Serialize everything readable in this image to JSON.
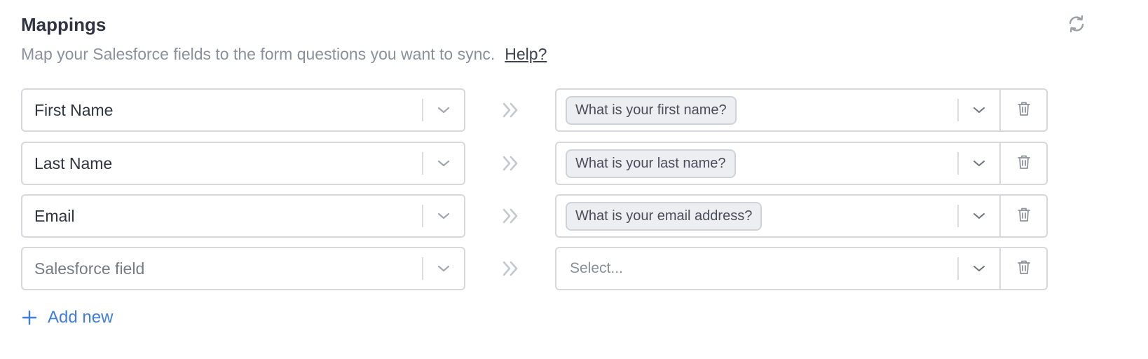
{
  "header": {
    "title": "Mappings",
    "subtitle": "Map your Salesforce fields to the form questions you want to sync.",
    "help_link": "Help?",
    "refresh_icon": "refresh-icon"
  },
  "mappings": [
    {
      "salesforce_field": "First Name",
      "form_question": "What is your first name?"
    },
    {
      "salesforce_field": "Last Name",
      "form_question": "What is your last name?"
    },
    {
      "salesforce_field": "Email",
      "form_question": "What is your email address?"
    },
    {
      "salesforce_field_placeholder": "Salesforce field",
      "form_question_placeholder": "Select..."
    }
  ],
  "add_new": {
    "label": "Add new",
    "icon": "plus-icon"
  },
  "colors": {
    "accent": "#3f7de0",
    "title": "#2f3342",
    "muted_text": "#8b909b",
    "border": "#d6d8dd",
    "chip_bg": "#eceef1"
  }
}
